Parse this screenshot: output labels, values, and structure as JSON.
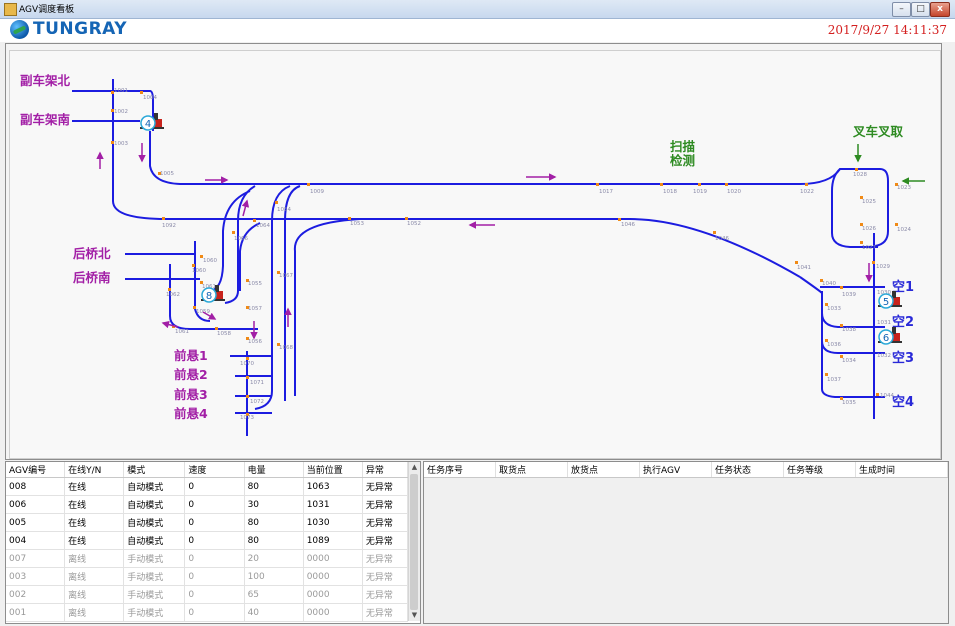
{
  "window": {
    "title": "AGV调度看板",
    "minimize": "–",
    "maximize": "□",
    "close": "x"
  },
  "header": {
    "logo_text": "TUNGRAY",
    "datetime": "2017/9/27  14:11:37"
  },
  "colors": {
    "track": "#1c1ce0",
    "area_label": "#a21fa6",
    "green_label": "#2e8b22",
    "empty_label": "#2929d8",
    "node_marker": "#f08a16",
    "alert": "#d42020"
  },
  "map": {
    "area_labels": {
      "fuchejia_bei": "副车架北",
      "fuchejia_nan": "副车架南",
      "houqiao_bei": "后桥北",
      "houqiao_nan": "后桥南",
      "qianxuan_1": "前悬1",
      "qianxuan_2": "前悬2",
      "qianxuan_3": "前悬3",
      "qianxuan_4": "前悬4",
      "saomiao_1": "扫描",
      "saomiao_2": "检测",
      "chache": "叉车叉取",
      "kong_1": "空1",
      "kong_2": "空2",
      "kong_3": "空3",
      "kong_4": "空4"
    },
    "agvs": [
      "4",
      "8",
      "5",
      "6"
    ],
    "nodes": {
      "n1001": "1001",
      "n1002": "1002",
      "n1003": "1003",
      "n1004": "1004",
      "n1005": "1005",
      "n1009": "1009",
      "n1017": "1017",
      "n1018": "1018",
      "n1019": "1019",
      "n1020": "1020",
      "n1022": "1022",
      "n1023": "1023",
      "n1024": "1024",
      "n1025": "1025",
      "n1026": "1026",
      "n1027": "1027",
      "n1028": "1028",
      "n1029": "1029",
      "n1030": "1030",
      "n1031": "1031",
      "n1032": "1032",
      "n1033": "1033",
      "n1034": "1034",
      "n1035": "1035",
      "n1036": "1036",
      "n1037": "1037",
      "n1038": "1038",
      "n1039": "1039",
      "n1040": "1040",
      "n1041": "1041",
      "n1044": "1044",
      "n1046": "1046",
      "n1052": "1052",
      "n1053": "1053",
      "n1054": "1054",
      "n1055": "1055",
      "n1056": "1056",
      "n1057": "1057",
      "n1058": "1058",
      "n1059": "1059",
      "n1060": "1060",
      "n1061": "1061",
      "n1062": "1062",
      "n1063": "1063",
      "n1064": "1064",
      "n1065": "1065",
      "n1066": "1066",
      "n1067": "1067",
      "n1068": "1068",
      "n1070": "1070",
      "n1071": "1071",
      "n1072": "1072",
      "n1073": "1073",
      "n1092": "1092"
    }
  },
  "agv_table": {
    "headers": [
      "AGV编号",
      "在线Y/N",
      "模式",
      "速度",
      "电量",
      "当前位置",
      "异常"
    ],
    "rows": [
      {
        "id": "008",
        "online": "在线",
        "mode": "自动模式",
        "speed": "0",
        "battery": "80",
        "position": "1063",
        "error": "无异常",
        "state": "online"
      },
      {
        "id": "006",
        "online": "在线",
        "mode": "自动模式",
        "speed": "0",
        "battery": "30",
        "position": "1031",
        "error": "无异常",
        "state": "online",
        "low_battery": true
      },
      {
        "id": "005",
        "online": "在线",
        "mode": "自动模式",
        "speed": "0",
        "battery": "80",
        "position": "1030",
        "error": "无异常",
        "state": "online"
      },
      {
        "id": "004",
        "online": "在线",
        "mode": "自动模式",
        "speed": "0",
        "battery": "80",
        "position": "1089",
        "error": "无异常",
        "state": "online"
      },
      {
        "id": "007",
        "online": "离线",
        "mode": "手动模式",
        "speed": "0",
        "battery": "20",
        "position": "0000",
        "error": "无异常",
        "state": "offline"
      },
      {
        "id": "003",
        "online": "离线",
        "mode": "手动模式",
        "speed": "0",
        "battery": "100",
        "position": "0000",
        "error": "无异常",
        "state": "offline"
      },
      {
        "id": "002",
        "online": "离线",
        "mode": "手动模式",
        "speed": "0",
        "battery": "65",
        "position": "0000",
        "error": "无异常",
        "state": "offline"
      },
      {
        "id": "001",
        "online": "离线",
        "mode": "手动模式",
        "speed": "0",
        "battery": "40",
        "position": "0000",
        "error": "无异常",
        "state": "offline"
      }
    ]
  },
  "task_table": {
    "headers": [
      "任务序号",
      "取货点",
      "放货点",
      "执行AGV",
      "任务状态",
      "任务等级",
      "生成时间"
    ]
  }
}
